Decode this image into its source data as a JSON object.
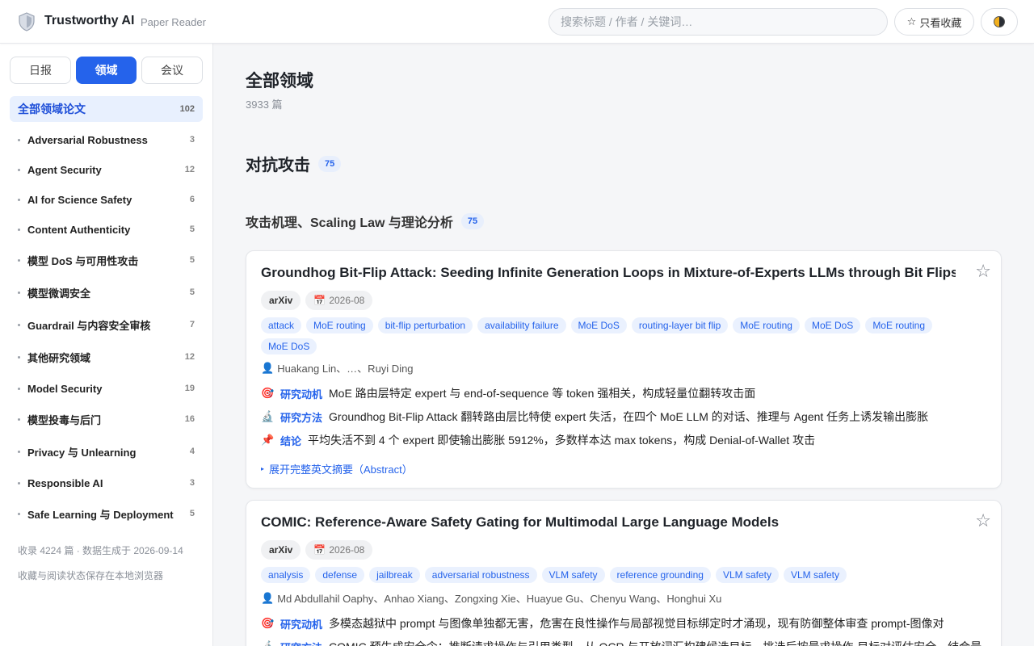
{
  "header": {
    "brand": "Trustworthy AI",
    "subtitle": "Paper Reader",
    "search_placeholder": "搜索标题 / 作者 / 关键词…",
    "fav_label": "只看收藏"
  },
  "sidebar": {
    "tabs": [
      {
        "label": "日报",
        "active": false
      },
      {
        "label": "领域",
        "active": true
      },
      {
        "label": "会议",
        "active": false
      }
    ],
    "all": {
      "label": "全部领域论文",
      "count": "102"
    },
    "items": [
      {
        "label": "Adversarial Robustness",
        "count": "3"
      },
      {
        "label": "Agent Security",
        "count": "12"
      },
      {
        "label": "AI for Science Safety",
        "count": "6"
      },
      {
        "label": "Content Authenticity",
        "count": "5"
      },
      {
        "label": "模型 DoS 与可用性攻击",
        "count": "5"
      },
      {
        "label": "模型微调安全",
        "count": "5"
      },
      {
        "label": "Guardrail 与内容安全审核",
        "count": "7"
      },
      {
        "label": "其他研究领域",
        "count": "12"
      },
      {
        "label": "Model Security",
        "count": "19"
      },
      {
        "label": "模型投毒与后门",
        "count": "16"
      },
      {
        "label": "Privacy 与 Unlearning",
        "count": "4"
      },
      {
        "label": "Responsible AI",
        "count": "3"
      },
      {
        "label": "Safe Learning 与 Deployment",
        "count": "5"
      }
    ],
    "footer_1": "收录 4224 篇 · 数据生成于 2026-09-14",
    "footer_2": "收藏与阅读状态保存在本地浏览器"
  },
  "main": {
    "title": "全部领域",
    "count": "3933 篇",
    "section": {
      "title": "对抗攻击",
      "count": "75"
    },
    "subsection": {
      "title": "攻击机理、Scaling Law 与理论分析",
      "count": "75"
    },
    "labels": {
      "motivation": "研究动机",
      "method": "研究方法",
      "conclusion": "结论"
    },
    "papers": [
      {
        "title": "Groundhog Bit-Flip Attack: Seeding Infinite Generation Loops in Mixture-of-Experts LLMs through Bit Flips",
        "source": "arXiv",
        "date": "2026-08",
        "tags": [
          "attack",
          "MoE routing",
          "bit-flip perturbation",
          "availability failure",
          "MoE DoS",
          "routing-layer bit flip",
          "MoE routing",
          "MoE DoS",
          "MoE routing",
          "MoE DoS"
        ],
        "authors": "Huakang Lin、…、Ruyi Ding",
        "motivation": "MoE 路由层特定 expert 与 end-of-sequence 等 token 强相关，构成轻量位翻转攻击面",
        "method": "Groundhog Bit-Flip Attack 翻转路由层比特使 expert 失活，在四个 MoE LLM 的对话、推理与 Agent 任务上诱发输出膨胀",
        "conclusion": "平均失活不到 4 个 expert 即使输出膨胀 5912%，多数样本达 max tokens，构成 Denial-of-Wallet 攻击",
        "expand": "展开完整英文摘要（Abstract）"
      },
      {
        "title": "COMIC: Reference-Aware Safety Gating for Multimodal Large Language Models",
        "source": "arXiv",
        "date": "2026-08",
        "tags": [
          "analysis",
          "defense",
          "jailbreak",
          "adversarial robustness",
          "VLM safety",
          "reference grounding",
          "VLM safety",
          "VLM safety"
        ],
        "authors": "Md Abdullahil Oaphy、Anhao Xiang、Zongxing Xie、Huayue Gu、Chenyu Wang、Honghui Xu",
        "motivation": "多模态越狱中 prompt 与图像单独都无害，危害在良性操作与局部视觉目标绑定时才涌现，现有防御整体审查 prompt-图像对",
        "method": "COMIC 预生成安全令：推断请求操作与引用类型，从 OCR 与开放词汇构建候选目标，挑选后按最求操作-目标对评估安全，结合最"
      }
    ]
  }
}
